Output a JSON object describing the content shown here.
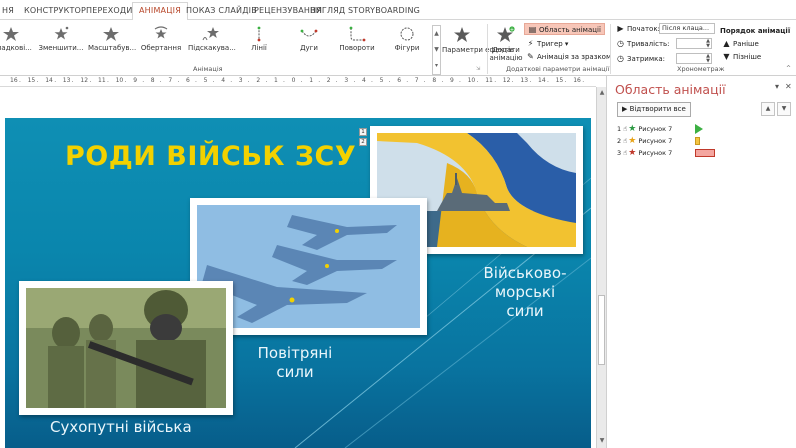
{
  "tabs": [
    {
      "label": "НЯ",
      "active": false
    },
    {
      "label": "КОНСТРУКТОР",
      "active": false
    },
    {
      "label": "ПЕРЕХОДИ",
      "active": false
    },
    {
      "label": "АНІМАЦІЯ",
      "active": true
    },
    {
      "label": "ПОКАЗ СЛАЙДІВ",
      "active": false
    },
    {
      "label": "РЕЦЕНЗУВАННЯ",
      "active": false
    },
    {
      "label": "ВИГЛЯД",
      "active": false
    },
    {
      "label": "STORYBOARDING",
      "active": false
    }
  ],
  "ribbon": {
    "effects": [
      {
        "label": "...падкові...",
        "icon": "random-bars-star-icon"
      },
      {
        "label": "Зменшити...",
        "icon": "shrink-star-icon"
      },
      {
        "label": "Масштабув...",
        "icon": "zoom-star-icon"
      },
      {
        "label": "Обертання",
        "icon": "spin-star-icon"
      },
      {
        "label": "Підскакува...",
        "icon": "bounce-star-icon"
      },
      {
        "label": "Лінії",
        "icon": "lines-path-icon"
      },
      {
        "label": "Дуги",
        "icon": "arcs-path-icon"
      },
      {
        "label": "Повороти",
        "icon": "turns-path-icon"
      },
      {
        "label": "Фігури",
        "icon": "shapes-path-icon"
      }
    ],
    "effect_options": "Параметри ефектів",
    "add_animation_line1": "Додати",
    "add_animation_line2": "анімацію",
    "animation_pane": "Область анімації",
    "trigger": "Тригер",
    "animation_painter": "Анімація за зразком",
    "group_animation": "Анімація",
    "group_advanced": "Додаткові параметри анімації",
    "group_timing": "Хронометраж",
    "start_label": "Початок:",
    "start_value": "Після клаца...",
    "duration_label": "Тривалість:",
    "delay_label": "Затримка:",
    "reorder_title": "Порядок анімації",
    "move_earlier": "Раніше",
    "move_later": "Пізніше"
  },
  "ruler_numbers": [
    "16",
    "15",
    "14",
    "13",
    "12",
    "11",
    "10",
    "9",
    "8",
    "7",
    "6",
    "5",
    "4",
    "3",
    "2",
    "1",
    "0",
    "1",
    "2",
    "3",
    "4",
    "5",
    "6",
    "7",
    "8",
    "9",
    "10",
    "11",
    "12",
    "13",
    "14",
    "15",
    "16"
  ],
  "slide": {
    "title": "РОДИ ВІЙСЬК ЗСУ",
    "caption_army": "Сухопутні війська",
    "caption_air_1": "Повітряні",
    "caption_air_2": "сили",
    "caption_navy_1": "Військово-",
    "caption_navy_2": "морські",
    "caption_navy_3": "сили",
    "marker_1": "1",
    "marker_2": "2"
  },
  "pane": {
    "title": "Область анімації",
    "play_all": "Відтворити все",
    "items": [
      {
        "num": "1",
        "name": "Рисунок 7",
        "star_color": "#2e9a44",
        "bar_color": "#3cb043",
        "bar_type": "entrance"
      },
      {
        "num": "2",
        "name": "Рисунок 7",
        "star_color": "#e8a317",
        "bar_color": "#f5c542",
        "bar_type": "emphasis"
      },
      {
        "num": "3",
        "name": "Рисунок 7",
        "star_color": "#c0392b",
        "bar_color": "#f4a6a0",
        "bar_type": "exit"
      }
    ]
  }
}
